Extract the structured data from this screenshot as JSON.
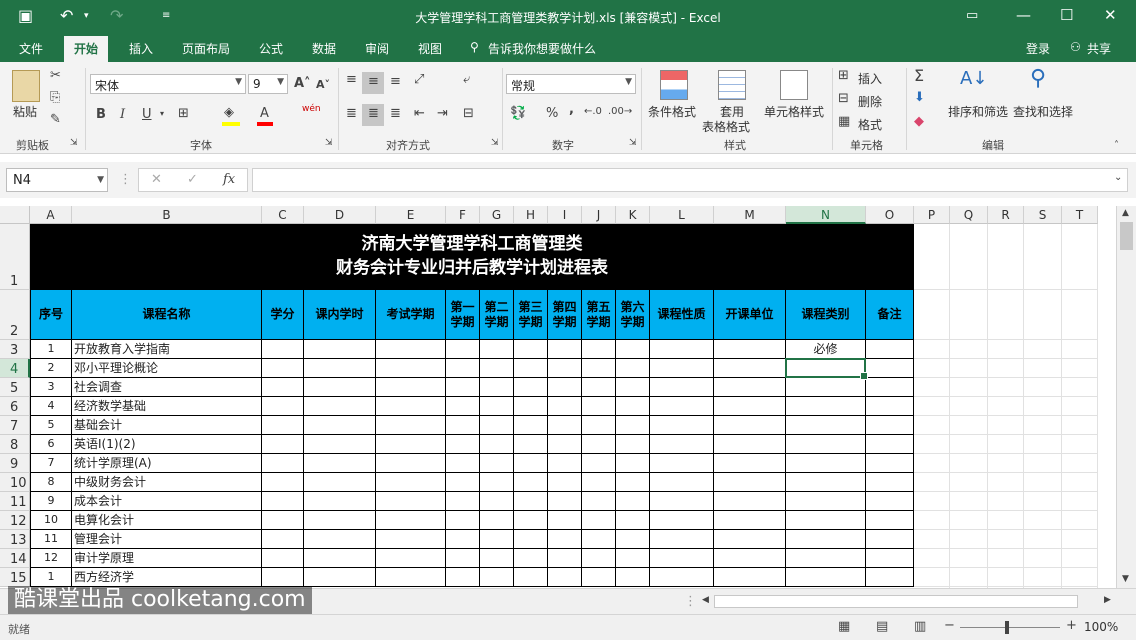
{
  "window": {
    "title": "大学管理学科工商管理类教学计划.xls  [兼容模式] - Excel",
    "login": "登录",
    "share": "共享"
  },
  "tabs": [
    "文件",
    "开始",
    "插入",
    "页面布局",
    "公式",
    "数据",
    "审阅",
    "视图"
  ],
  "tell_me": "告诉我你想要做什么",
  "ribbon": {
    "clipboard": {
      "label": "剪贴板",
      "paste": "粘贴"
    },
    "font": {
      "label": "字体",
      "name": "宋体",
      "size": "9",
      "bold": "B",
      "italic": "I",
      "underline": "U",
      "wen": "wén",
      "font_color_letter": "A"
    },
    "alignment": {
      "label": "对齐方式"
    },
    "number": {
      "label": "数字",
      "format": "常规",
      "percent": "%",
      "comma": ","
    },
    "styles": {
      "label": "样式",
      "conditional": "条件格式",
      "table_format_1": "套用",
      "table_format_2": "表格格式",
      "cell_styles": "单元格样式"
    },
    "cells": {
      "label": "单元格",
      "insert": "插入",
      "delete": "删除",
      "format": "格式"
    },
    "editing": {
      "label": "编辑",
      "sort": "排序和筛选",
      "find": "查找和选择",
      "sigma": "Σ"
    }
  },
  "formula_bar": {
    "name_box": "N4",
    "fx": "fx",
    "formula": ""
  },
  "columns": [
    "A",
    "B",
    "C",
    "D",
    "E",
    "F",
    "G",
    "H",
    "I",
    "J",
    "K",
    "L",
    "M",
    "N",
    "O",
    "P",
    "Q",
    "R",
    "S",
    "T"
  ],
  "selected_column": "N",
  "rows": [
    "1",
    "2",
    "3",
    "4",
    "5",
    "6",
    "7",
    "8",
    "9",
    "10",
    "11",
    "12",
    "13",
    "14",
    "15"
  ],
  "selected_row": "4",
  "sheet": {
    "title_line1": "济南大学管理学科工商管理类",
    "title_line2": "财务会计专业归并后教学计划进程表",
    "headers": [
      "序号",
      "课程名称",
      "学分",
      "课内学时",
      "考试学期",
      "第一学期",
      "第二学期",
      "第三学期",
      "第四学期",
      "第五学期",
      "第六学期",
      "课程性质",
      "开课单位",
      "课程类别",
      "备注"
    ],
    "data": [
      {
        "no": "1",
        "name": "开放教育入学指南",
        "category": "必修"
      },
      {
        "no": "2",
        "name": "邓小平理论概论",
        "category": ""
      },
      {
        "no": "3",
        "name": "社会调查",
        "category": ""
      },
      {
        "no": "4",
        "name": "经济数学基础",
        "category": ""
      },
      {
        "no": "5",
        "name": "基础会计",
        "category": ""
      },
      {
        "no": "6",
        "name": "英语Ⅰ(1)(2)",
        "category": ""
      },
      {
        "no": "7",
        "name": "统计学原理(A)",
        "category": ""
      },
      {
        "no": "8",
        "name": "中级财务会计",
        "category": ""
      },
      {
        "no": "9",
        "name": "成本会计",
        "category": ""
      },
      {
        "no": "10",
        "name": "电算化会计",
        "category": ""
      },
      {
        "no": "11",
        "name": "管理会计",
        "category": ""
      },
      {
        "no": "12",
        "name": "审计学原理",
        "category": ""
      },
      {
        "no": "1",
        "name": "西方经济学",
        "category": ""
      }
    ]
  },
  "status": {
    "ready": "就绪",
    "zoom": "100%"
  },
  "watermark": "酷课堂出品 coolketang.com"
}
